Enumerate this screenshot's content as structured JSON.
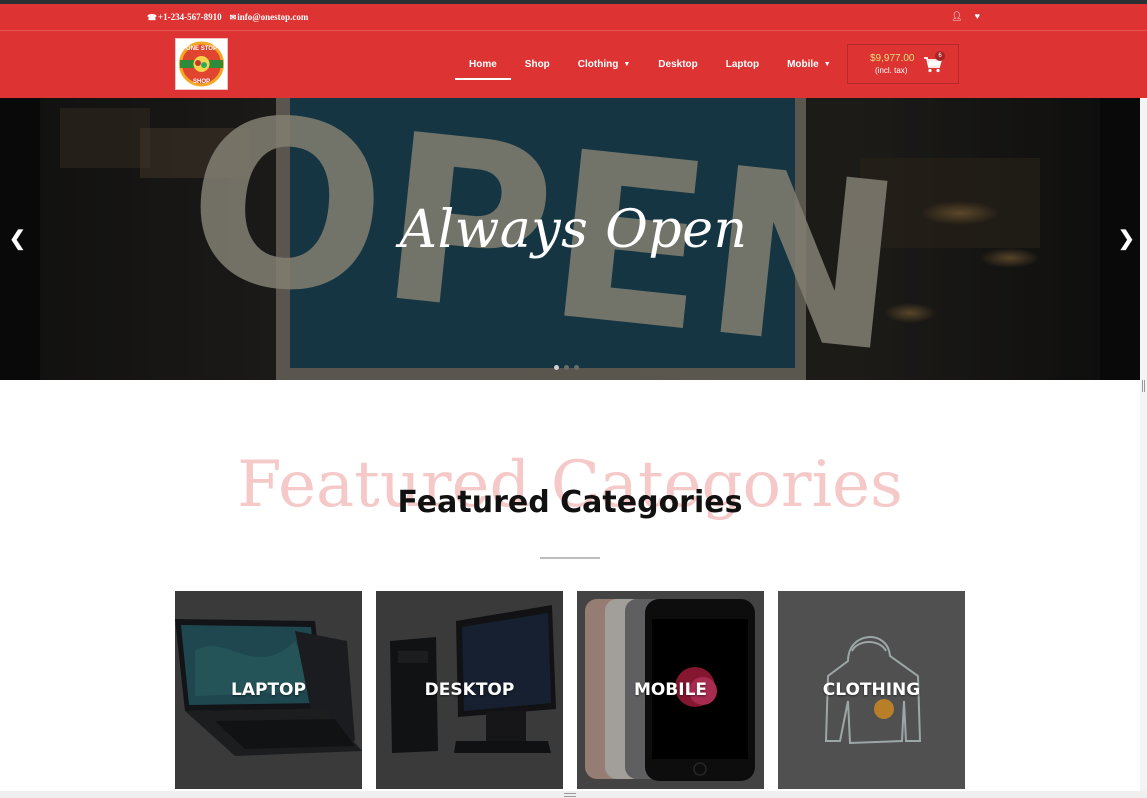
{
  "topbar": {
    "phone": "+1-234-567-8910",
    "email": "info@onestop.com",
    "phone_icon": "phone-icon",
    "email_icon": "envelope-icon",
    "user_icon": "user-icon",
    "wishlist_icon": "heart-icon"
  },
  "header": {
    "logo_text": "ONE STOP SHOP",
    "nav": [
      {
        "label": "Home",
        "active": true,
        "dropdown": false
      },
      {
        "label": "Shop",
        "active": false,
        "dropdown": false
      },
      {
        "label": "Clothing",
        "active": false,
        "dropdown": true
      },
      {
        "label": "Desktop",
        "active": false,
        "dropdown": false
      },
      {
        "label": "Laptop",
        "active": false,
        "dropdown": false
      },
      {
        "label": "Mobile",
        "active": false,
        "dropdown": true
      }
    ],
    "cart": {
      "amount": "$9,977.00",
      "tax_note": "(incl. tax)",
      "count": "6",
      "icon": "cart-icon"
    }
  },
  "hero": {
    "headline": "Always Open",
    "sign_text": "OPEN",
    "prev_icon": "chevron-left-icon",
    "next_icon": "chevron-right-icon",
    "slide_count": 3,
    "active_slide": 1
  },
  "featured": {
    "background_text": "Featured Categories",
    "title": "Featured Categories",
    "categories": [
      {
        "label": "LAPTOP"
      },
      {
        "label": "DESKTOP"
      },
      {
        "label": "MOBILE"
      },
      {
        "label": "CLOTHING"
      }
    ]
  },
  "colors": {
    "brand_red": "#dd3333",
    "price_color": "#e6df7b",
    "watermark": "#f6c9c9"
  }
}
